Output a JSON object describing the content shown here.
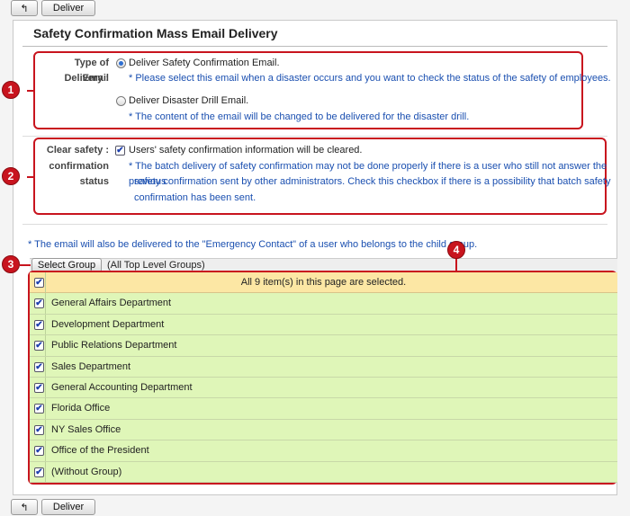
{
  "toolbar": {
    "back_icon": "↰",
    "deliver_label": "Deliver"
  },
  "page": {
    "title": "Safety Confirmation Mass Email Delivery"
  },
  "markers": [
    "1",
    "2",
    "3",
    "4"
  ],
  "delivery": {
    "label_line1": "Type of Delivery :",
    "label_line2": "Email",
    "option1_label": "Deliver Safety Confirmation Email.",
    "option1_note": "* Please select this email when a disaster occurs and you want to check the status of the safety of employees.",
    "option1_selected": true,
    "option2_label": "Deliver Disaster Drill Email.",
    "option2_note": "* The content of the email will be changed to be delivered for the disaster drill.",
    "option2_selected": false
  },
  "clear": {
    "label_line1": "Clear safety :",
    "label_line2": "confirmation",
    "label_line3": "status",
    "checkbox_label": "Users' safety confirmation information will be cleared.",
    "checked": true,
    "note_line1": "* The batch delivery of safety confirmation may not be done properly if there is a user who still not answer the previous",
    "note_line2": "safety confirmation sent by other administrators. Check this checkbox if there is a possibility that batch safety",
    "note_line3": "confirmation has been sent."
  },
  "emergency_note": "* The email will also be delivered to the \"Emergency Contact\" of a user who belongs to the child group.",
  "group": {
    "select_button_label": "Select Group",
    "selected_text": "(All Top Level Groups)"
  },
  "grid": {
    "header_text": "All  9 item(s) in this page are selected.",
    "rows": [
      "General Affairs Department",
      "Development Department",
      "Public Relations Department",
      "Sales Department",
      "General Accounting Department",
      "Florida Office",
      "NY Sales Office",
      "Office of the President",
      "(Without Group)"
    ]
  },
  "colors": {
    "annotation_red": "#c8141e",
    "note_blue": "#1a4fb0",
    "row_green": "#dff6b8",
    "header_yellow": "#fce7a4"
  }
}
